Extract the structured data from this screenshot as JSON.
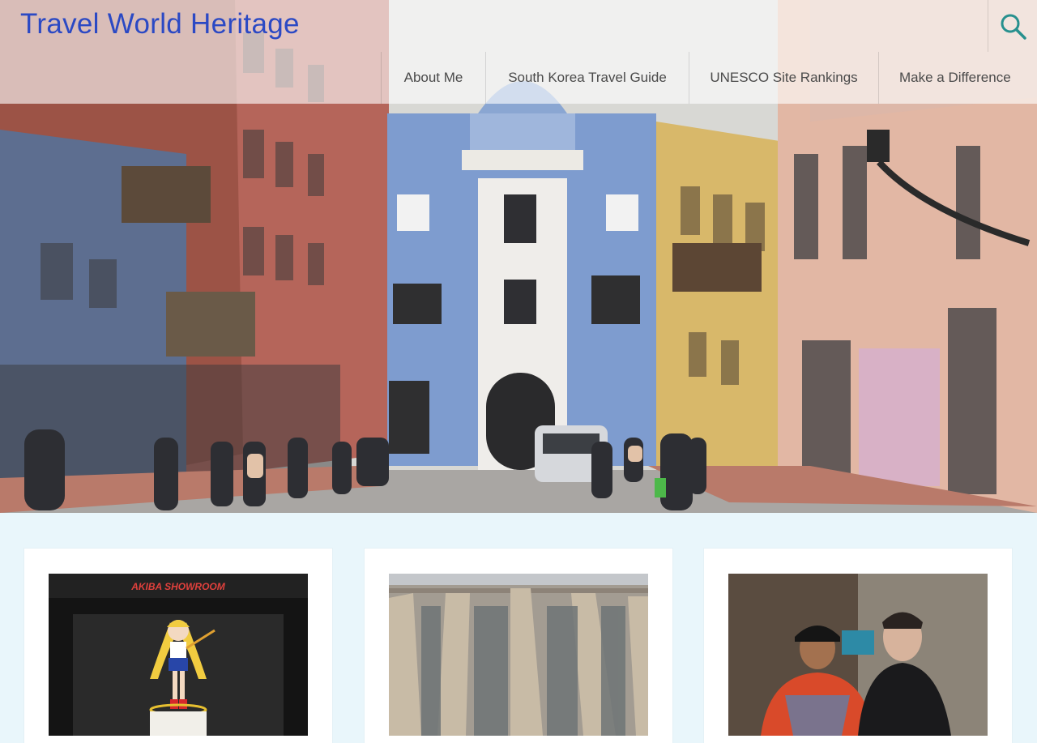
{
  "site": {
    "title": "Travel World Heritage"
  },
  "search": {
    "icon": "search-icon"
  },
  "nav": {
    "items": [
      {
        "label": "About Me"
      },
      {
        "label": "South Korea Travel Guide"
      },
      {
        "label": "UNESCO Site Rankings"
      },
      {
        "label": "Make a Difference"
      }
    ]
  },
  "hero": {
    "image": "colonial-street-with-blue-building"
  },
  "cards": [
    {
      "image": "anime-figure-in-showroom",
      "sign_text": "AKIBA SHOWROOM"
    },
    {
      "image": "terracotta-army-pit"
    },
    {
      "image": "two-men-portrait"
    }
  ],
  "colors": {
    "title": "#2b49c4",
    "nav_text": "#4a4a4a",
    "page_bg": "#e9f6fb",
    "search_icon": "#27908e"
  }
}
